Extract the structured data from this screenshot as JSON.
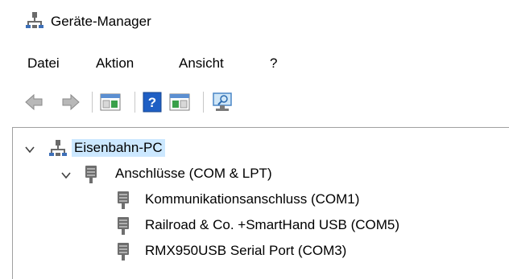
{
  "window": {
    "title": "Geräte-Manager",
    "icon": "device-manager-icon"
  },
  "menu": {
    "items": [
      {
        "label": "Datei"
      },
      {
        "label": "Aktion"
      },
      {
        "label": "Ansicht"
      },
      {
        "label": "?"
      }
    ]
  },
  "toolbar": {
    "buttons": [
      {
        "icon": "back-arrow-icon"
      },
      {
        "icon": "forward-arrow-icon"
      },
      {
        "icon": "properties-icon"
      },
      {
        "icon": "help-icon"
      },
      {
        "icon": "details-view-icon"
      },
      {
        "icon": "scan-hardware-icon"
      }
    ]
  },
  "tree": {
    "root": {
      "label": "Eisenbahn-PC",
      "icon": "computer-icon",
      "expanded": true,
      "selected": true,
      "children": [
        {
          "label": "Anschlüsse (COM & LPT)",
          "icon": "port-icon",
          "expanded": true,
          "children": [
            {
              "label": "Kommunikationsanschluss (COM1)",
              "icon": "port-icon"
            },
            {
              "label": "Railroad & Co. +SmartHand USB (COM5)",
              "icon": "port-icon"
            },
            {
              "label": "RMX950USB Serial Port (COM3)",
              "icon": "port-icon"
            }
          ]
        }
      ]
    }
  },
  "colors": {
    "selection": "#cce8ff",
    "arrow": "#a0a0a0",
    "help_blue": "#1f5fc4"
  }
}
